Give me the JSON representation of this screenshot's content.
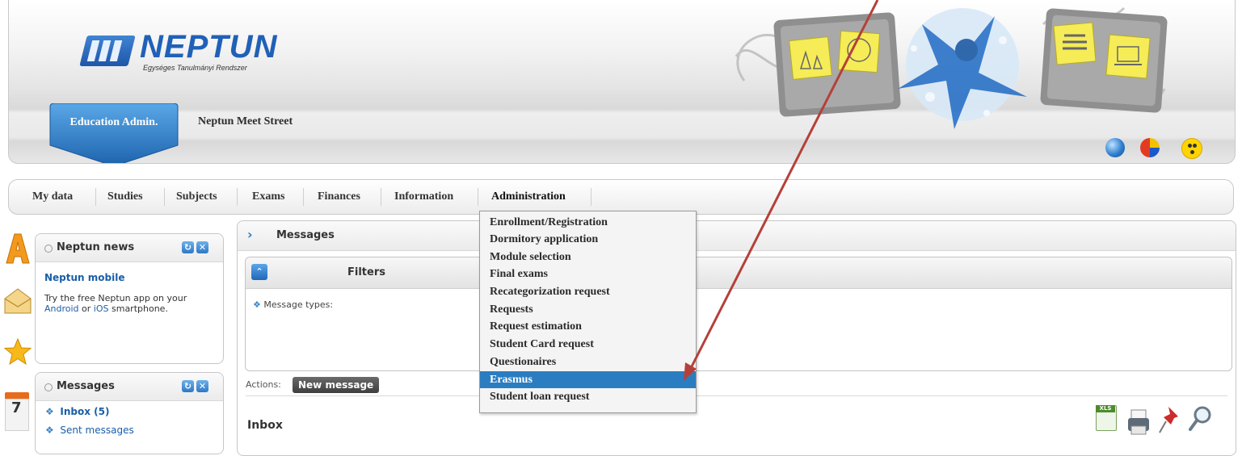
{
  "header": {
    "logo_text": "NEPTUN",
    "logo_subtitle": "Egységes Tanulmányi Rendszer",
    "role_tab": "Education Admin.",
    "site_name": "Neptun Meet Street"
  },
  "nav": {
    "items": [
      "My data",
      "Studies",
      "Subjects",
      "Exams",
      "Finances",
      "Information",
      "Administration"
    ]
  },
  "dropdown": {
    "items": [
      "Enrollment/Registration",
      "Dormitory application",
      "Module selection",
      "Final exams",
      "Recategorization request",
      "Requests",
      "Request estimation",
      "Student Card request",
      "Questionaires",
      "Erasmus",
      "Student loan request"
    ],
    "active": "Erasmus"
  },
  "news_box": {
    "title": "Neptun news",
    "item_title": "Neptun mobile",
    "text_before": "Try the free Neptun app on your",
    "link_android": "Android",
    "text_or": "or",
    "link_ios": "iOS",
    "text_after": "smartphone."
  },
  "messages_box": {
    "title": "Messages",
    "links": [
      "Inbox (5)",
      "Sent messages"
    ]
  },
  "main": {
    "title": "Messages",
    "filters_title": "Filters",
    "message_types_label": "Message types:",
    "actions_label": "Actions:",
    "new_message_button": "New message",
    "section_title": "Inbox",
    "export_label": "XLS"
  },
  "calendar_icon_day": "7",
  "colors": {
    "accent_blue": "#2b7dc1",
    "tab_blue": "#2f7fc9",
    "annotation_arrow": "#b5403a"
  }
}
